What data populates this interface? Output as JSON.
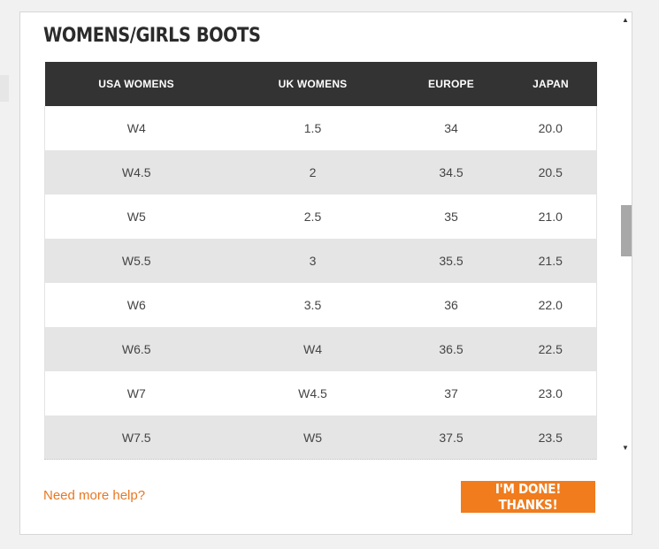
{
  "title": "WOMENS/GIRLS BOOTS",
  "table": {
    "headers": [
      "USA WOMENS",
      "UK WOMENS",
      "EUROPE",
      "JAPAN"
    ],
    "rows": [
      [
        "W4",
        "1.5",
        "34",
        "20.0"
      ],
      [
        "W4.5",
        "2",
        "34.5",
        "20.5"
      ],
      [
        "W5",
        "2.5",
        "35",
        "21.0"
      ],
      [
        "W5.5",
        "3",
        "35.5",
        "21.5"
      ],
      [
        "W6",
        "3.5",
        "36",
        "22.0"
      ],
      [
        "W6.5",
        "W4",
        "36.5",
        "22.5"
      ],
      [
        "W7",
        "W4.5",
        "37",
        "23.0"
      ],
      [
        "W7.5",
        "W5",
        "37.5",
        "23.5"
      ]
    ]
  },
  "footer": {
    "help_link": "Need more help?",
    "done_label": "I'M DONE! THANKS!"
  },
  "scrollbar": {
    "up_icon": "▲",
    "down_icon": "▼"
  },
  "colors": {
    "accent": "#f07c1e",
    "header_bg": "#333333",
    "stripe": "#e5e5e5",
    "link": "#e87722"
  }
}
